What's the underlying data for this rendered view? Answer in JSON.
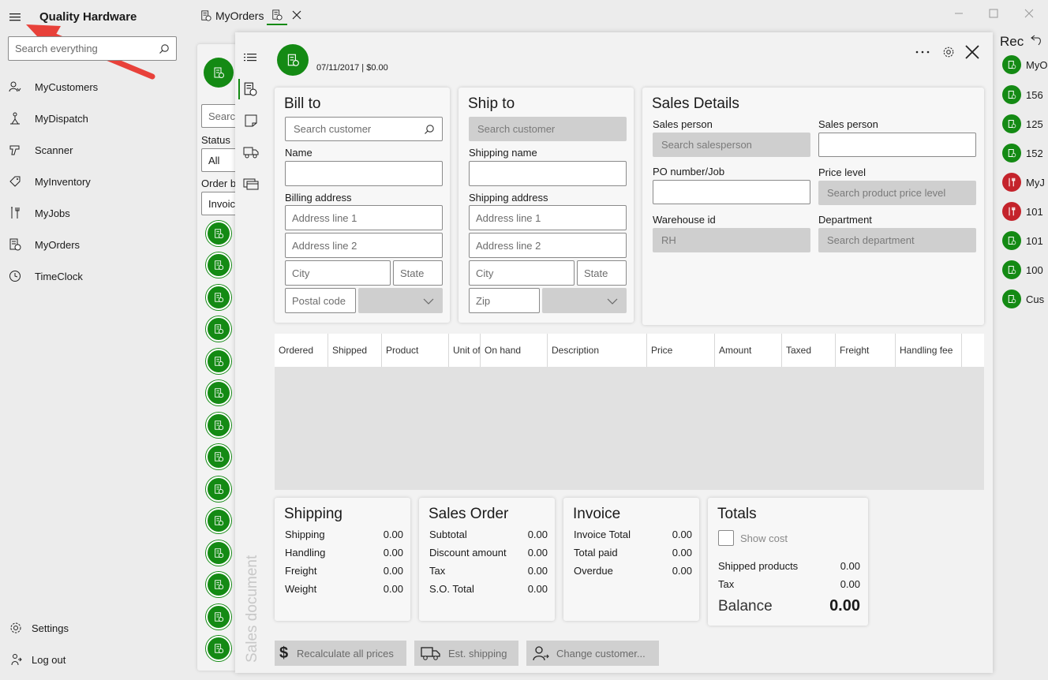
{
  "app": {
    "title": "Quality Hardware",
    "search_placeholder": "Search everything"
  },
  "nav": {
    "items": [
      {
        "label": "MyCustomers",
        "icon": "person-icon"
      },
      {
        "label": "MyDispatch",
        "icon": "dispatch-icon"
      },
      {
        "label": "Scanner",
        "icon": "scanner-icon"
      },
      {
        "label": "MyInventory",
        "icon": "inventory-tag-icon"
      },
      {
        "label": "MyJobs",
        "icon": "tools-icon"
      },
      {
        "label": "MyOrders",
        "icon": "orders-icon"
      },
      {
        "label": "TimeClock",
        "icon": "clock-icon"
      }
    ],
    "settings": "Settings",
    "logout": "Log out"
  },
  "tabs": [
    {
      "label": "MyOrders",
      "icon": "orders-icon"
    }
  ],
  "list_panel": {
    "search_placeholder": "Searc",
    "status_label": "Status",
    "status_value": "All",
    "order_label": "Order b",
    "order_value": "Invoic"
  },
  "document": {
    "header_info": "07/11/2017 | $0.00",
    "vertical_label": "Sales document"
  },
  "bill_to": {
    "title": "Bill to",
    "search_placeholder": "Search customer",
    "name_label": "Name",
    "billing_address_label": "Billing address",
    "address1_placeholder": "Address line 1",
    "address2_placeholder": "Address line 2",
    "city_placeholder": "City",
    "state_placeholder": "State",
    "postal_placeholder": "Postal code"
  },
  "ship_to": {
    "title": "Ship to",
    "search_placeholder": "Search customer",
    "name_label": "Shipping name",
    "address_label": "Shipping address",
    "address1_placeholder": "Address line 1",
    "address2_placeholder": "Address line 2",
    "city_placeholder": "City",
    "state_placeholder": "State",
    "zip_placeholder": "Zip"
  },
  "sales_details": {
    "title": "Sales Details",
    "sales_person_label": "Sales person",
    "sales_person_placeholder": "Search salesperson",
    "sales_person2_label": "Sales person",
    "po_label": "PO number/Job",
    "price_level_label": "Price level",
    "price_level_placeholder": "Search product price level",
    "warehouse_label": "Warehouse id",
    "warehouse_value": "RH",
    "department_label": "Department",
    "department_placeholder": "Search department"
  },
  "table": {
    "columns": [
      "Ordered",
      "Shipped",
      "Product",
      "Unit of",
      "On hand",
      "Description",
      "Price",
      "Amount",
      "Taxed",
      "Freight",
      "Handling fee"
    ]
  },
  "shipping_summary": {
    "title": "Shipping",
    "rows": [
      {
        "label": "Shipping",
        "value": "0.00"
      },
      {
        "label": "Handling",
        "value": "0.00"
      },
      {
        "label": "Freight",
        "value": "0.00"
      },
      {
        "label": "Weight",
        "value": "0.00"
      }
    ]
  },
  "sales_order_summary": {
    "title": "Sales Order",
    "rows": [
      {
        "label": "Subtotal",
        "value": "0.00"
      },
      {
        "label": "Discount amount",
        "value": "0.00"
      },
      {
        "label": "Tax",
        "value": "0.00"
      },
      {
        "label": "S.O. Total",
        "value": "0.00"
      }
    ]
  },
  "invoice_summary": {
    "title": "Invoice",
    "rows": [
      {
        "label": "Invoice Total",
        "value": "0.00"
      },
      {
        "label": "Total paid",
        "value": "0.00"
      },
      {
        "label": "Overdue",
        "value": "0.00"
      }
    ]
  },
  "totals": {
    "title": "Totals",
    "show_cost": "Show cost",
    "rows": [
      {
        "label": "Shipped products",
        "value": "0.00"
      },
      {
        "label": "Tax",
        "value": "0.00"
      }
    ],
    "balance_label": "Balance",
    "balance_value": "0.00"
  },
  "buttons": {
    "recalculate": "Recalculate all prices",
    "est_shipping": "Est. shipping",
    "change_customer": "Change customer..."
  },
  "recent": {
    "title": "Rec",
    "items": [
      {
        "label": "MyO",
        "color": "green"
      },
      {
        "label": "156",
        "color": "green"
      },
      {
        "label": "125",
        "color": "green"
      },
      {
        "label": "152",
        "color": "green"
      },
      {
        "label": "MyJ",
        "color": "red"
      },
      {
        "label": "101",
        "color": "red"
      },
      {
        "label": "101",
        "color": "green"
      },
      {
        "label": "100",
        "color": "green"
      },
      {
        "label": "Cus",
        "color": "green"
      }
    ]
  },
  "colors": {
    "accent_green": "#148a14",
    "accent_red": "#c4232b",
    "tab_underline": "#148a14"
  }
}
